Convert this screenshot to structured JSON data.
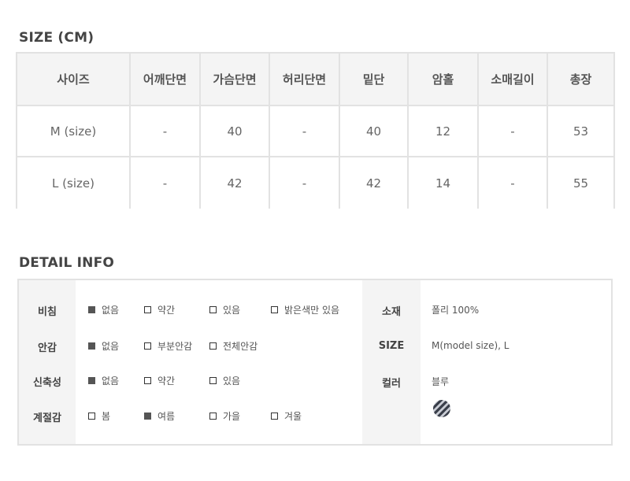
{
  "size_section": {
    "title": "SIZE (CM)",
    "headers": [
      "사이즈",
      "어깨단면",
      "가슴단면",
      "허리단면",
      "밑단",
      "암홀",
      "소매길이",
      "총장"
    ],
    "rows": [
      [
        "M (size)",
        "-",
        "40",
        "-",
        "40",
        "12",
        "-",
        "53"
      ],
      [
        "L (size)",
        "-",
        "42",
        "-",
        "42",
        "14",
        "-",
        "55"
      ]
    ]
  },
  "detail_section": {
    "title": "DETAIL INFO",
    "attributes": [
      {
        "label": "비침",
        "options": [
          {
            "label": "없음",
            "checked": true
          },
          {
            "label": "약간",
            "checked": false
          },
          {
            "label": "있음",
            "checked": false
          },
          {
            "label": "밝은색만 있음",
            "checked": false
          }
        ]
      },
      {
        "label": "안감",
        "options": [
          {
            "label": "없음",
            "checked": true
          },
          {
            "label": "부분안감",
            "checked": false
          },
          {
            "label": "전체안감",
            "checked": false
          }
        ]
      },
      {
        "label": "신축성",
        "options": [
          {
            "label": "없음",
            "checked": true
          },
          {
            "label": "약간",
            "checked": false
          },
          {
            "label": "있음",
            "checked": false
          }
        ]
      },
      {
        "label": "계절감",
        "options": [
          {
            "label": "봄",
            "checked": false
          },
          {
            "label": "여름",
            "checked": true
          },
          {
            "label": "가을",
            "checked": false
          },
          {
            "label": "겨울",
            "checked": false
          }
        ]
      }
    ],
    "specs": [
      {
        "label": "소재",
        "value": "폴리 100%"
      },
      {
        "label": "SIZE",
        "value": "M(model size), L"
      },
      {
        "label": "컬러",
        "value": "블루"
      }
    ],
    "color_swatch_icon": "striped-blue-swatch"
  }
}
